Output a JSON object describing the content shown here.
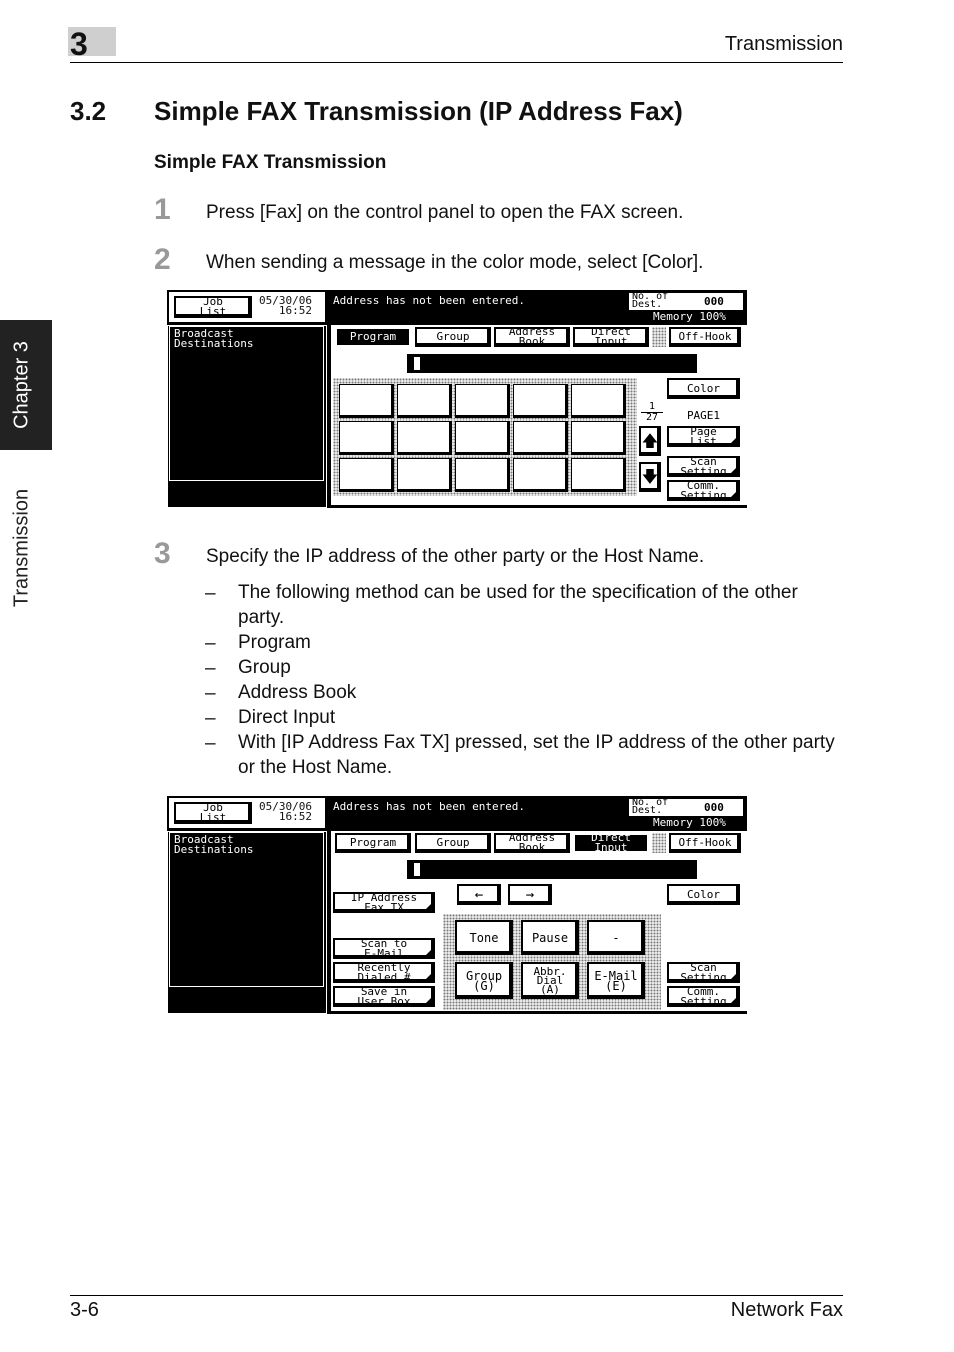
{
  "header": {
    "chapter_number": "3",
    "title": "Transmission"
  },
  "side_tab": {
    "chapter": "Chapter 3",
    "section": "Transmission"
  },
  "section": {
    "number": "3.2",
    "title": "Simple FAX Transmission (IP Address Fax)",
    "subheading": "Simple FAX Transmission"
  },
  "steps": [
    {
      "number": "1",
      "text": "Press [Fax] on the control panel to open the FAX screen."
    },
    {
      "number": "2",
      "text": "When sending a message in the color mode, select [Color]."
    },
    {
      "number": "3",
      "text": "Specify the IP address of the other party or the Host Name."
    }
  ],
  "bullets": [
    {
      "dash": "–",
      "text": "The following method can be used for the specification of the other party."
    },
    {
      "dash": "–",
      "text": "Program"
    },
    {
      "dash": "–",
      "text": "Group"
    },
    {
      "dash": "–",
      "text": "Address Book"
    },
    {
      "dash": "–",
      "text": "Direct Input"
    },
    {
      "dash": "–",
      "text": "With [IP Address Fax TX] pressed, set the IP address of the other party or the Host Name."
    }
  ],
  "screen1": {
    "job_list": "Job\nList",
    "date": "05/30/06",
    "time": "16:52",
    "message": "Address has not been entered.",
    "no_of_dest_label": "No. of\nDest.",
    "no_of_dest_value": "000",
    "memory": "Memory 100%",
    "broadcast": "Broadcast\nDestinations",
    "tabs": [
      "Program",
      "Group",
      "Address\nBook",
      "Direct\nInput"
    ],
    "off_hook": "Off-Hook",
    "color": "Color",
    "page_top": "1",
    "page_bottom": "27",
    "page_label": "PAGE1",
    "page_list": "Page\nList",
    "scan_setting": "Scan\nSetting",
    "comm_setting": "Comm.\nSetting",
    "up_icon": "arrow-up-icon",
    "down_icon": "arrow-down-icon"
  },
  "screen2": {
    "job_list": "Job\nList",
    "date": "05/30/06",
    "time": "16:52",
    "message": "Address has not been entered.",
    "no_of_dest_label": "No. of\nDest.",
    "no_of_dest_value": "000",
    "memory": "Memory 100%",
    "broadcast": "Broadcast\nDestinations",
    "tabs": [
      "Program",
      "Group",
      "Address\nBook",
      "Direct\nInput"
    ],
    "off_hook": "Off-Hook",
    "ip_fax": "IP Address\nFax TX",
    "scan_to_email": "Scan to\nE-Mail",
    "recently_dialed": "Recently\nDialed #",
    "save_in_user_box": "Save in\nUser Box",
    "arrow_left": "←",
    "arrow_right": "→",
    "color": "Color",
    "tone": "Tone",
    "pause": "Pause",
    "dash_key": "-",
    "group_g": "Group\n(G)",
    "abbr_dial": "Abbr.\nDial\n(A)",
    "email_e": "E-Mail\n(E)",
    "scan_setting": "Scan\nSetting",
    "comm_setting": "Comm.\nSetting"
  },
  "footer": {
    "page": "3-6",
    "title": "Network Fax"
  }
}
